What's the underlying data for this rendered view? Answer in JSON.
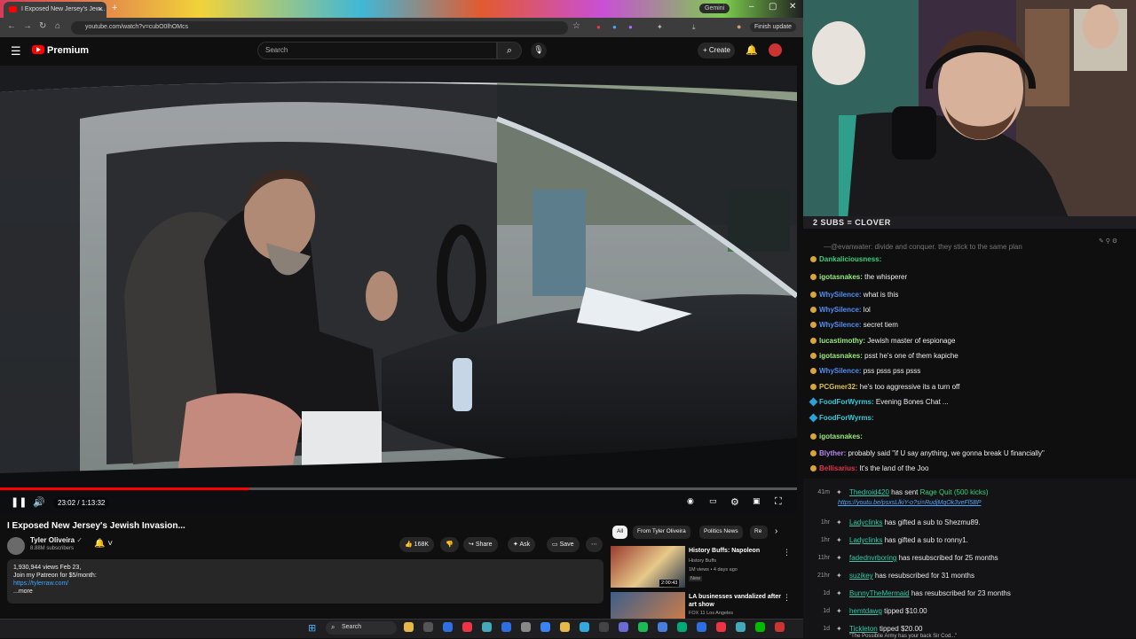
{
  "browser": {
    "tab_title": "I Exposed New Jersey's Jew...",
    "url": "youtube.com/watch?v=cubO0lhOMcs",
    "gemini_label": "Gemini",
    "finish_update_label": "Finish update"
  },
  "youtube": {
    "brand": "Premium",
    "search_placeholder": "Search",
    "create_label": "Create"
  },
  "player": {
    "time_display": "23:02 / 1:13:32",
    "progress_fraction": 0.313
  },
  "video": {
    "title": "I Exposed New Jersey's Jewish Invasion...",
    "channel_name": "Tyler Oliveira",
    "subscribers": "8.88M subscribers",
    "like_count": "168K",
    "share_label": "Share",
    "ask_label": "Ask",
    "save_label": "Save",
    "description_line1": "1,930,944 views  Feb 23,",
    "description_line2": "Join my Patreon for $5/month:",
    "description_link": "https://tylerraw.com/",
    "more_label": "...more"
  },
  "recs": {
    "chips": [
      "All",
      "From Tyler Oliveira",
      "Politics News",
      "Re"
    ],
    "items": [
      {
        "title": "History Buffs: Napoleon",
        "channel": "History Buffs",
        "meta": "1M views • 4 days ago",
        "badge": "New",
        "duration": "2:00:43"
      },
      {
        "title": "LA businesses vandalized after art show",
        "channel": "FOX 11 Los Angeles",
        "meta": "",
        "badge": "",
        "duration": ""
      }
    ]
  },
  "stream": {
    "subs_goal": "2 SUBS = CLOVER"
  },
  "chat": {
    "faded": "—@evanwater: divide and conquer. they stick to the same plan",
    "messages": [
      {
        "user": "Dankaliciousness:",
        "text": "",
        "color": "#3bd07a"
      },
      {
        "user": "igotasnakes:",
        "text": "the whisperer",
        "color": "#9aea7a"
      },
      {
        "user": "WhySilence:",
        "text": "what is this",
        "color": "#4f8df0"
      },
      {
        "user": "WhySilence:",
        "text": "lol",
        "color": "#4f8df0"
      },
      {
        "user": "WhySilence:",
        "text": "secret tiem",
        "color": "#4f8df0"
      },
      {
        "user": "lucastimothy:",
        "text": "Jewish master of espionage",
        "color": "#9aea7a"
      },
      {
        "user": "igotasnakes:",
        "text": "psst he's one of them kapiche",
        "color": "#9aea7a"
      },
      {
        "user": "WhySilence:",
        "text": "pss psss pss psss",
        "color": "#4f8df0"
      },
      {
        "user": "PCGmer32:",
        "text": "he's too aggressive its a turn off",
        "color": "#e0c34a"
      },
      {
        "user": "FoodForWyrms:",
        "text": "Evening Bones Chat ...",
        "color": "#34c8d8"
      },
      {
        "user": "FoodForWyrms:",
        "text": "",
        "color": "#34c8d8"
      },
      {
        "user": "igotasnakes:",
        "text": "",
        "color": "#9aea7a"
      },
      {
        "user": "Blyther:",
        "text": "probably said \"if U say anything, we gonna break U financially\"",
        "color": "#b488f0"
      },
      {
        "user": "Bellisarius:",
        "text": "It's the land of the Joo",
        "color": "#e0334a"
      }
    ]
  },
  "events": [
    {
      "time": "41m",
      "user": "Thedroid420",
      "action": "has sent",
      "extra": "Rage Quit (500 kicks)",
      "link": "https://youtu.be/psxsLlkiY-o?si=RudjMqOk3veFl5BP"
    },
    {
      "time": "1hr",
      "user": "Ladyclinks",
      "action": "has gifted a sub to Shezmu89."
    },
    {
      "time": "1hr",
      "user": "Ladyclinks",
      "action": "has gifted a sub to ronny1."
    },
    {
      "time": "11hr",
      "user": "fadednvrboring",
      "action": "has resubscribed for 25 months"
    },
    {
      "time": "21hr",
      "user": "suzikey",
      "action": "has resubscribed for 31 months"
    },
    {
      "time": "1d",
      "user": "BunnyTheMermaid",
      "action": "has resubscribed for 23 months"
    },
    {
      "time": "1d",
      "user": "hemtdawg",
      "action": "tipped $10.00"
    },
    {
      "time": "1d",
      "user": "Tickleton",
      "action": "tipped $20.00",
      "extra2": "\"The Possiblie Army has your back Sir Cod...\""
    }
  ],
  "taskbar": {
    "search_label": "Search"
  },
  "colors": {
    "accent": "#ff0000",
    "link": "#3ea6ff",
    "chat_bg": "#0f0f10"
  }
}
